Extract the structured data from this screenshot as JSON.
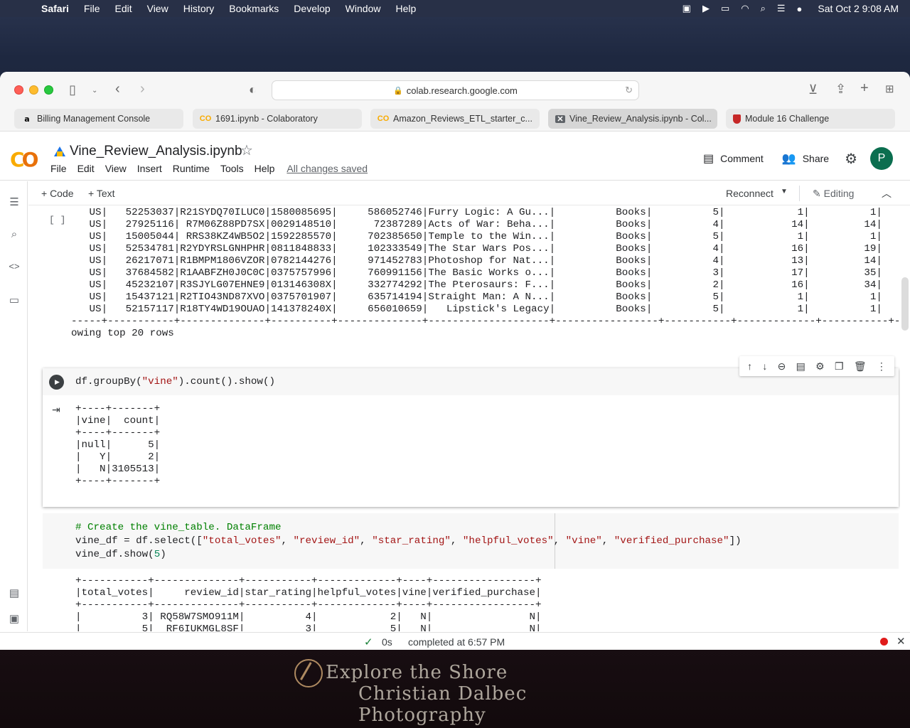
{
  "menubar": {
    "app": "Safari",
    "items": [
      "File",
      "Edit",
      "View",
      "History",
      "Bookmarks",
      "Develop",
      "Window",
      "Help"
    ],
    "clock": "Sat Oct 2  9:08 AM"
  },
  "browser": {
    "url": "colab.research.google.com",
    "tabs": [
      {
        "label": "Billing Management Console",
        "icon": "amazon-icon"
      },
      {
        "label": "1691.ipynb - Colaboratory",
        "icon": "colab-icon"
      },
      {
        "label": "Amazon_Reviews_ETL_starter_c...",
        "icon": "colab-icon"
      },
      {
        "label": "Vine_Review_Analysis.ipynb - Col...",
        "icon": "colab-x-icon",
        "active": true
      },
      {
        "label": "Module 16 Challenge",
        "icon": "shield-icon"
      }
    ]
  },
  "colab": {
    "notebook_title": "Vine_Review_Analysis.ipynb",
    "menu": [
      "File",
      "Edit",
      "View",
      "Insert",
      "Runtime",
      "Tools",
      "Help"
    ],
    "saved_status": "All changes saved",
    "comment_label": "Comment",
    "share_label": "Share",
    "avatar_initial": "P",
    "add_code": "+ Code",
    "add_text": "+ Text",
    "reconnect": "Reconnect",
    "editing": "Editing"
  },
  "cells": {
    "prev_output": "   US|   52253037|R21SYDQ70ILUC0|1580085695|     586052746|Furry Logic: A Gu...|          Books|          5|            1|          1|\n   US|   27925116| R7M06Z88PD7SX|0029148510|      72387289|Acts of War: Beha...|          Books|          4|           14|         14|\n   US|   15005044| RRS38KZ4WB5O2|1592285570|     702385650|Temple to the Win...|          Books|          5|            1|          1|\n   US|   52534781|R2YDYRSLGNHPHR|0811848833|     102333549|The Star Wars Pos...|          Books|          4|           16|         19|\n   US|   26217071|R1BMPM1806VZOR|0782144276|     971452783|Photoshop for Nat...|          Books|          4|           13|         14|\n   US|   37684582|R1AABFZH0J0C0C|0375757996|     760991156|The Basic Works o...|          Books|          3|           17|         35|\n   US|   45232107|R3SJYLG07EHNE9|013146308X|     332774292|The Pterosaurs: F...|          Books|          2|           16|         34|\n   US|   15437121|R2TIO43ND87XVO|0375701907|     635714194|Straight Man: A N...|          Books|          5|            1|          1|\n   US|   52157117|R18TY4WD19OUAO|141378240X|     656010659|   Lipstick's Legacy|          Books|          5|            1|          1|\n-----+-----------+--------------+----------+--------------+--------------------+-----------------+-----------+-------------+-----------+----\nowing top 20 rows",
    "cell2_code_prefix": "df.groupBy(",
    "cell2_code_str": "\"vine\"",
    "cell2_code_suffix": ").count().show()",
    "cell2_output": "+----+-------+\n|vine|  count|\n+----+-------+\n|null|      5|\n|   Y|      2|\n|   N|3105513|\n+----+-------+",
    "cell3_comment": "# Create the vine_table. DataFrame",
    "cell3_line2_prefix": "vine_df = df.select([",
    "cell3_cols": [
      "\"total_votes\"",
      "\"review_id\"",
      "\"star_rating\"",
      "\"helpful_votes\"",
      "\"vine\"",
      "\"verified_purchase\""
    ],
    "cell3_line2_suffix": "])",
    "cell3_line3_prefix": "vine_df.show(",
    "cell3_line3_num": "5",
    "cell3_line3_suffix": ")",
    "cell3_output": "+-----------+--------------+-----------+-------------+----+-----------------+\n|total_votes|     review_id|star_rating|helpful_votes|vine|verified_purchase|\n+-----------+--------------+-----------+-------------+----+-----------------+\n|          3| RQ58W7SMO911M|          4|            2|   N|                N|\n|          5|  RF6IUKMGL8SF|          3|            5|   N|                N|",
    "empty_bracket": "[ ]"
  },
  "status": {
    "seconds": "0s",
    "message": "completed at 6:57 PM"
  },
  "desktop": {
    "watermark_line1": "Explore the Shore",
    "watermark_line2": "Christian Dalbec Photography"
  }
}
